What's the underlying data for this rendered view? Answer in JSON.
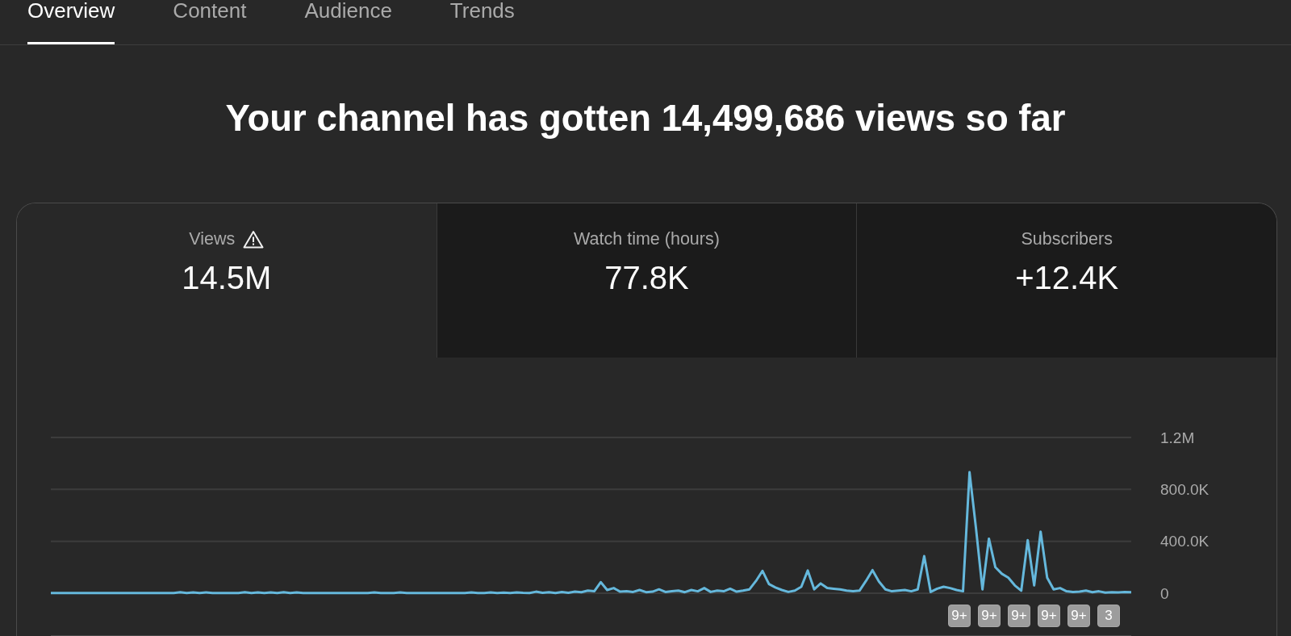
{
  "tabs": [
    {
      "label": "Overview",
      "selected": true
    },
    {
      "label": "Content",
      "selected": false
    },
    {
      "label": "Audience",
      "selected": false
    },
    {
      "label": "Trends",
      "selected": false
    }
  ],
  "headline": "Your channel has gotten 14,499,686 views so far",
  "metrics": [
    {
      "label": "Views",
      "value": "14.5M",
      "selected": true,
      "warning": true
    },
    {
      "label": "Watch time (hours)",
      "value": "77.8K",
      "selected": false,
      "warning": false
    },
    {
      "label": "Subscribers",
      "value": "+12.4K",
      "selected": false,
      "warning": false
    }
  ],
  "chart": {
    "chart_data": {
      "type": "line",
      "ylim": [
        0,
        1200000
      ],
      "yticks": [
        0,
        {
          "value": 400000,
          "label": "400.0K"
        },
        {
          "value": 800000,
          "label": "800.0K"
        },
        {
          "value": 1200000,
          "label": "1.2M"
        }
      ],
      "series": [
        {
          "color": "#65b8dc",
          "values": [
            2000,
            2000,
            2000,
            2000,
            2000,
            2000,
            2000,
            2000,
            2000,
            2000,
            2000,
            2000,
            2000,
            2000,
            2000,
            2000,
            2000,
            2000,
            2000,
            2000,
            8000,
            2000,
            6000,
            2000,
            7000,
            2000,
            2000,
            2000,
            2000,
            2000,
            8000,
            2000,
            7000,
            2000,
            7000,
            2000,
            8000,
            2000,
            6000,
            2000,
            2000,
            2000,
            2000,
            2000,
            2000,
            2000,
            2000,
            2000,
            2000,
            2000,
            7000,
            2000,
            2000,
            2000,
            6000,
            2000,
            2000,
            2000,
            2000,
            2000,
            2000,
            2000,
            2000,
            2000,
            2000,
            7000,
            2000,
            2000,
            6000,
            2000,
            5000,
            2000,
            6000,
            3000,
            2000,
            12000,
            3000,
            8000,
            2000,
            10000,
            4000,
            12000,
            8000,
            20000,
            15000,
            85000,
            25000,
            40000,
            12000,
            15000,
            10000,
            25000,
            8000,
            12000,
            30000,
            10000,
            15000,
            20000,
            8000,
            25000,
            15000,
            40000,
            10000,
            20000,
            15000,
            35000,
            12000,
            20000,
            30000,
            95000,
            172000,
            70000,
            45000,
            25000,
            10000,
            20000,
            50000,
            175000,
            30000,
            75000,
            40000,
            35000,
            30000,
            20000,
            15000,
            20000,
            95000,
            178000,
            90000,
            30000,
            15000,
            20000,
            25000,
            15000,
            30000,
            286000,
            10000,
            35000,
            50000,
            40000,
            25000,
            15000,
            932000,
            500000,
            30000,
            420000,
            200000,
            150000,
            120000,
            60000,
            20000,
            409000,
            60000,
            474000,
            120000,
            30000,
            40000,
            15000,
            10000,
            12000,
            20000,
            8000,
            15000,
            5000,
            8000,
            6000,
            10000,
            8000
          ]
        }
      ]
    },
    "event_badges": [
      {
        "label": "9+"
      },
      {
        "label": "9+"
      },
      {
        "label": "9+"
      },
      {
        "label": "9+"
      },
      {
        "label": "9+"
      },
      {
        "label": "3"
      }
    ]
  }
}
